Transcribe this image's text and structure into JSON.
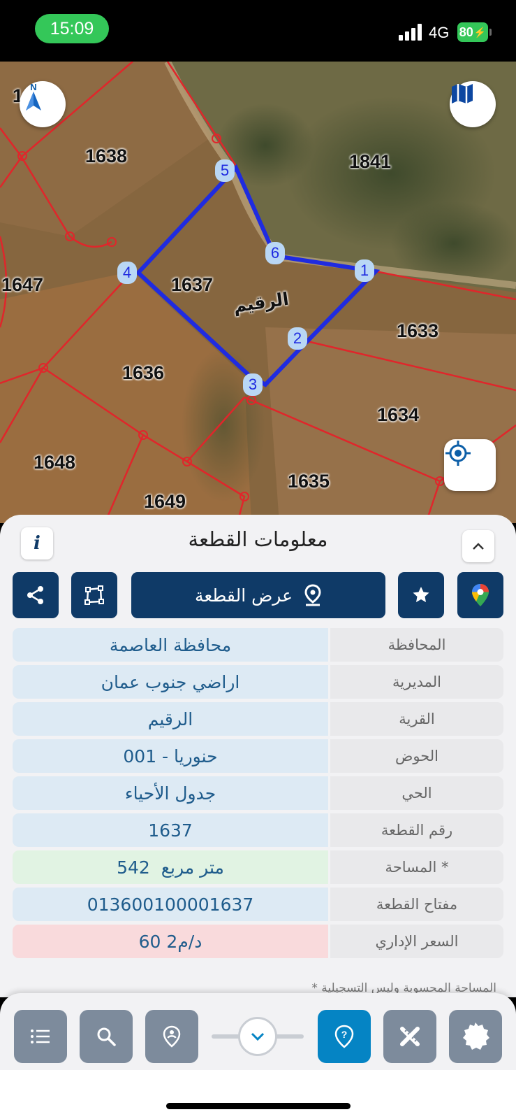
{
  "status_bar": {
    "time": "15:09",
    "network": "4G",
    "battery": "80"
  },
  "map": {
    "parcel_labels": [
      "1638",
      "1841",
      "1647",
      "1637",
      "1633",
      "1636",
      "1634",
      "1648",
      "1635",
      "1649"
    ],
    "partial_label": "1",
    "place_name": "الرقيم",
    "vertices": [
      "1",
      "2",
      "3",
      "4",
      "5",
      "6"
    ],
    "colors": {
      "parcel_border": "#e0262b",
      "selected_border": "#1f2be0",
      "vertex_fill": "#b9d7f5"
    },
    "icons": {
      "compass": "north-compass-icon",
      "layers": "map-layers-icon",
      "locate": "locate-icon"
    }
  },
  "sheet": {
    "title": "معلومات القطعة",
    "info_icon": "i",
    "view_button": "عرض القطعة",
    "rows": [
      {
        "label": "المحافظة",
        "value": "محافظة العاصمة",
        "tone": "blue"
      },
      {
        "label": "المديرية",
        "value": "اراضي جنوب عمان",
        "tone": "blue"
      },
      {
        "label": "القرية",
        "value": "الرقيم",
        "tone": "blue"
      },
      {
        "label": "الحوض",
        "value": "حنوريا - 001",
        "tone": "blue"
      },
      {
        "label": "الحي",
        "value": "جدول الأحياء",
        "tone": "blue"
      },
      {
        "label": "رقم القطعة",
        "value": "1637",
        "tone": "blue"
      },
      {
        "label": "المساحة *",
        "value": "542  متر مربع",
        "tone": "green"
      },
      {
        "label": "مفتاح القطعة",
        "value": "013600100001637",
        "tone": "blue"
      },
      {
        "label": "السعر الإداري",
        "value": "60 د/م2",
        "tone": "red"
      }
    ],
    "note": "* المساحة المحسوبة وليس التسجيلية"
  },
  "colors": {
    "navy": "#0f3a67",
    "active": "#0584c4",
    "button_grey": "#7d8b9c"
  }
}
